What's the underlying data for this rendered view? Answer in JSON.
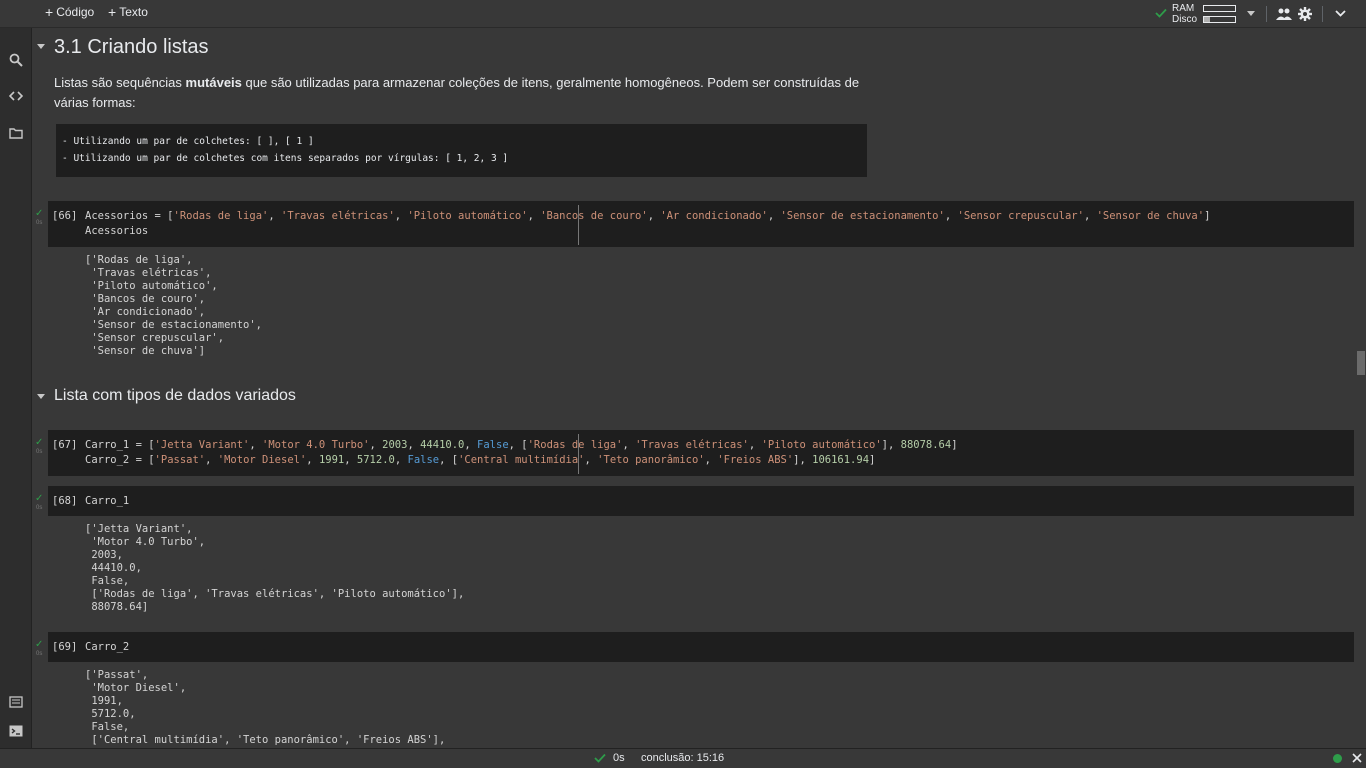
{
  "toolbar": {
    "code_label": "Código",
    "text_label": "Texto",
    "ram_label": "RAM",
    "disk_label": "Disco",
    "ram_fill": 0.0,
    "disk_fill": 0.2
  },
  "section1": {
    "title": "3.1 Criando listas",
    "para_before": "Listas são sequências ",
    "para_bold": "mutáveis",
    "para_after": " que são utilizadas para armazenar coleções de itens, geralmente homogêneos. Podem ser construídas de",
    "para_line2": "várias formas:",
    "code_block": [
      "- Utilizando um par de colchetes: [ ], [ 1 ]",
      "- Utilizando um par de colchetes com itens separados por vírgulas: [ 1, 2, 3 ]"
    ]
  },
  "cells": {
    "c66": {
      "number": "[66]",
      "runtime": "0s",
      "line2": "Acessorios",
      "output": [
        "['Rodas de liga',",
        " 'Travas elétricas',",
        " 'Piloto automático',",
        " 'Bancos de couro',",
        " 'Ar condicionado',",
        " 'Sensor de estacionamento',",
        " 'Sensor crepuscular',",
        " 'Sensor de chuva']"
      ]
    },
    "c67": {
      "number": "[67]",
      "runtime": "0s"
    },
    "c68": {
      "number": "[68]",
      "runtime": "0s",
      "code": "Carro_1",
      "output": [
        "['Jetta Variant',",
        " 'Motor 4.0 Turbo',",
        " 2003,",
        " 44410.0,",
        " False,",
        " ['Rodas de liga', 'Travas elétricas', 'Piloto automático'],",
        " 88078.64]"
      ]
    },
    "c69": {
      "number": "[69]",
      "runtime": "0s",
      "code": "Carro_2",
      "output": [
        "['Passat',",
        " 'Motor Diesel',",
        " 1991,",
        " 5712.0,",
        " False,",
        " ['Central multimídia', 'Teto panorâmico', 'Freios ABS'],"
      ]
    }
  },
  "section2": {
    "title": "Lista com tipos de dados variados"
  },
  "status": {
    "time": "0s",
    "completion": "conclusão: 15:16"
  },
  "colors": {
    "check_green": "#2e9d4a",
    "string": "#ce9178",
    "number": "#b5cea8",
    "keyword": "#569cd6"
  }
}
